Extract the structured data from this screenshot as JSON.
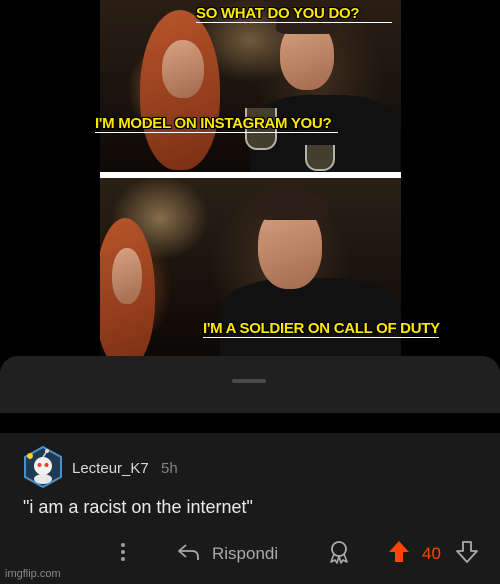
{
  "meme": {
    "caption_top": "SO WHAT DO YOU DO?",
    "caption_middle": "I'M MODEL ON INSTAGRAM YOU?",
    "caption_bottom": "I'M A SOLDIER ON CALL OF DUTY"
  },
  "comment": {
    "username": "Lecteur_K7",
    "time": "5h",
    "text": "\"i am a racist on the internet\"",
    "reply_label": "Rispondi",
    "vote_count": "40",
    "vote_color": "#ff4500"
  },
  "icons": {
    "more": "more-icon",
    "reply": "reply-icon",
    "award": "award-icon",
    "upvote": "upvote-icon",
    "downvote": "downvote-icon"
  },
  "watermark": "imgflip.com"
}
